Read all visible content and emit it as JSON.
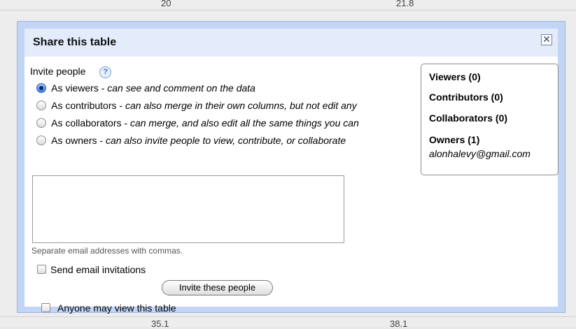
{
  "background": {
    "cells": [
      "20",
      "21.8",
      "35.1",
      "38.1"
    ]
  },
  "dialog": {
    "title": "Share this table",
    "close_glyph": "✕",
    "invite_label": "Invite people",
    "help_glyph": "?",
    "roles": [
      {
        "label": "As viewers - ",
        "desc": "can see and comment on the data",
        "selected": true
      },
      {
        "label": "As contributors - ",
        "desc": "can also merge in their own columns, but not edit any",
        "selected": false
      },
      {
        "label": "As collaborators - ",
        "desc": "can merge, and also edit all the same things you can",
        "selected": false
      },
      {
        "label": "As owners - ",
        "desc": "can also invite people to view, contribute, or collaborate",
        "selected": false
      }
    ],
    "email_value": "",
    "email_hint": "Separate email addresses with commas.",
    "send_email_label": "Send email invitations",
    "send_email_checked": false,
    "invite_button": "Invite these people",
    "anyone_label": "Anyone may view this table",
    "anyone_checked": false
  },
  "members": {
    "viewers": "Viewers (0)",
    "contributors": "Contributors (0)",
    "collaborators": "Collaborators (0)",
    "owners": "Owners (1)",
    "owner_email": "alonhalevy@gmail.com"
  },
  "colors": {
    "dialog_frame": "#c3d5f4",
    "title_bar": "#e4ecfb",
    "radio_selected": "#3a7fe8"
  }
}
